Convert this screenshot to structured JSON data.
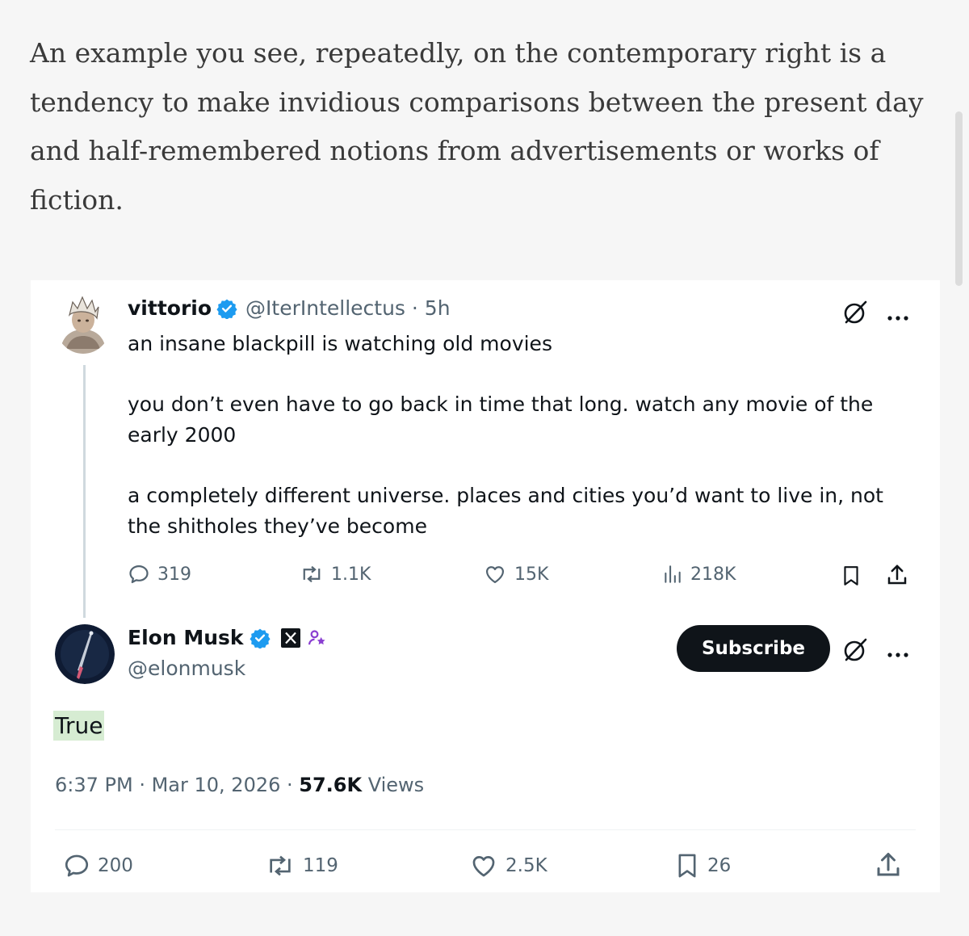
{
  "article": {
    "paragraph_lines": [
      "An example you see, repeatedly, on the contemporary right is a",
      "tendency to make invidious comparisons between the present day",
      "and half-remembered notions from advertisements or works of",
      "fiction."
    ]
  },
  "quoted_tweet": {
    "author_name": "vittorio",
    "handle_time": "@IterIntellectus · 5h",
    "text_lines": [
      "an insane blackpill is watching old movies",
      "you don’t even have to go back in time that long. watch any movie of the",
      "early 2000",
      "a completely different universe. places and cities you’d want to live in, not",
      "the shitholes they’ve become"
    ],
    "stats": {
      "replies": "319",
      "reposts": "1.1K",
      "likes": "15K",
      "views": "218K"
    }
  },
  "main_tweet": {
    "author_name": "Elon Musk",
    "handle": "@elonmusk",
    "subscribe_label": "Subscribe",
    "text": "True",
    "timestamp": "6:37 PM · Mar 10, 2026 · ",
    "views_count": "57.6K",
    "views_label": " Views",
    "stats": {
      "replies": "200",
      "reposts": "119",
      "likes": "2.5K",
      "bookmarks": "26"
    }
  },
  "colors": {
    "verified": "#1d9bf0",
    "text_primary": "#0f1419",
    "text_secondary": "#536471",
    "highlight": "#d6ecd2",
    "affiliate_badge": "#8a3fd1"
  },
  "icons": [
    "verified-badge-icon",
    "grok-icon",
    "more-icon",
    "reply-icon",
    "repost-icon",
    "like-icon",
    "views-icon",
    "bookmark-icon",
    "share-icon",
    "x-logo-icon",
    "affiliate-icon"
  ]
}
